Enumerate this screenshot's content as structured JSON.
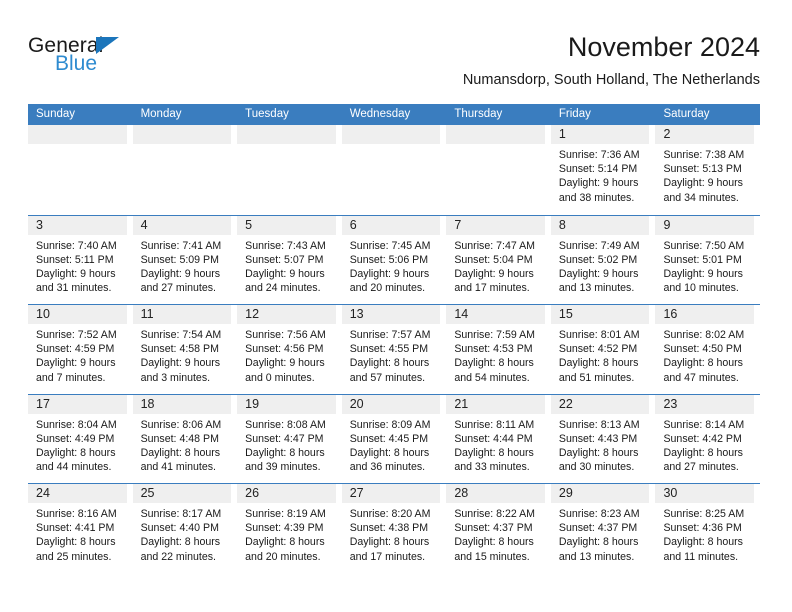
{
  "brand": {
    "word_one": "General",
    "word_two": "Blue",
    "triangle_color": "#1b75bb",
    "blue_text_color": "#2e8bd0"
  },
  "header": {
    "title": "November 2024",
    "subtitle": "Numansdorp, South Holland, The Netherlands"
  },
  "theme": {
    "header_blue": "#3a7dbf",
    "daynum_band": "#efefef",
    "page_background": "#ffffff",
    "text": "#1a1a1a"
  },
  "calendar": {
    "day_headers": [
      "Sunday",
      "Monday",
      "Tuesday",
      "Wednesday",
      "Thursday",
      "Friday",
      "Saturday"
    ],
    "weeks": [
      [
        {
          "day": "",
          "lines": []
        },
        {
          "day": "",
          "lines": []
        },
        {
          "day": "",
          "lines": []
        },
        {
          "day": "",
          "lines": []
        },
        {
          "day": "",
          "lines": []
        },
        {
          "day": "1",
          "lines": [
            "Sunrise: 7:36 AM",
            "Sunset: 5:14 PM",
            "Daylight: 9 hours",
            "and 38 minutes."
          ]
        },
        {
          "day": "2",
          "lines": [
            "Sunrise: 7:38 AM",
            "Sunset: 5:13 PM",
            "Daylight: 9 hours",
            "and 34 minutes."
          ]
        }
      ],
      [
        {
          "day": "3",
          "lines": [
            "Sunrise: 7:40 AM",
            "Sunset: 5:11 PM",
            "Daylight: 9 hours",
            "and 31 minutes."
          ]
        },
        {
          "day": "4",
          "lines": [
            "Sunrise: 7:41 AM",
            "Sunset: 5:09 PM",
            "Daylight: 9 hours",
            "and 27 minutes."
          ]
        },
        {
          "day": "5",
          "lines": [
            "Sunrise: 7:43 AM",
            "Sunset: 5:07 PM",
            "Daylight: 9 hours",
            "and 24 minutes."
          ]
        },
        {
          "day": "6",
          "lines": [
            "Sunrise: 7:45 AM",
            "Sunset: 5:06 PM",
            "Daylight: 9 hours",
            "and 20 minutes."
          ]
        },
        {
          "day": "7",
          "lines": [
            "Sunrise: 7:47 AM",
            "Sunset: 5:04 PM",
            "Daylight: 9 hours",
            "and 17 minutes."
          ]
        },
        {
          "day": "8",
          "lines": [
            "Sunrise: 7:49 AM",
            "Sunset: 5:02 PM",
            "Daylight: 9 hours",
            "and 13 minutes."
          ]
        },
        {
          "day": "9",
          "lines": [
            "Sunrise: 7:50 AM",
            "Sunset: 5:01 PM",
            "Daylight: 9 hours",
            "and 10 minutes."
          ]
        }
      ],
      [
        {
          "day": "10",
          "lines": [
            "Sunrise: 7:52 AM",
            "Sunset: 4:59 PM",
            "Daylight: 9 hours",
            "and 7 minutes."
          ]
        },
        {
          "day": "11",
          "lines": [
            "Sunrise: 7:54 AM",
            "Sunset: 4:58 PM",
            "Daylight: 9 hours",
            "and 3 minutes."
          ]
        },
        {
          "day": "12",
          "lines": [
            "Sunrise: 7:56 AM",
            "Sunset: 4:56 PM",
            "Daylight: 9 hours",
            "and 0 minutes."
          ]
        },
        {
          "day": "13",
          "lines": [
            "Sunrise: 7:57 AM",
            "Sunset: 4:55 PM",
            "Daylight: 8 hours",
            "and 57 minutes."
          ]
        },
        {
          "day": "14",
          "lines": [
            "Sunrise: 7:59 AM",
            "Sunset: 4:53 PM",
            "Daylight: 8 hours",
            "and 54 minutes."
          ]
        },
        {
          "day": "15",
          "lines": [
            "Sunrise: 8:01 AM",
            "Sunset: 4:52 PM",
            "Daylight: 8 hours",
            "and 51 minutes."
          ]
        },
        {
          "day": "16",
          "lines": [
            "Sunrise: 8:02 AM",
            "Sunset: 4:50 PM",
            "Daylight: 8 hours",
            "and 47 minutes."
          ]
        }
      ],
      [
        {
          "day": "17",
          "lines": [
            "Sunrise: 8:04 AM",
            "Sunset: 4:49 PM",
            "Daylight: 8 hours",
            "and 44 minutes."
          ]
        },
        {
          "day": "18",
          "lines": [
            "Sunrise: 8:06 AM",
            "Sunset: 4:48 PM",
            "Daylight: 8 hours",
            "and 41 minutes."
          ]
        },
        {
          "day": "19",
          "lines": [
            "Sunrise: 8:08 AM",
            "Sunset: 4:47 PM",
            "Daylight: 8 hours",
            "and 39 minutes."
          ]
        },
        {
          "day": "20",
          "lines": [
            "Sunrise: 8:09 AM",
            "Sunset: 4:45 PM",
            "Daylight: 8 hours",
            "and 36 minutes."
          ]
        },
        {
          "day": "21",
          "lines": [
            "Sunrise: 8:11 AM",
            "Sunset: 4:44 PM",
            "Daylight: 8 hours",
            "and 33 minutes."
          ]
        },
        {
          "day": "22",
          "lines": [
            "Sunrise: 8:13 AM",
            "Sunset: 4:43 PM",
            "Daylight: 8 hours",
            "and 30 minutes."
          ]
        },
        {
          "day": "23",
          "lines": [
            "Sunrise: 8:14 AM",
            "Sunset: 4:42 PM",
            "Daylight: 8 hours",
            "and 27 minutes."
          ]
        }
      ],
      [
        {
          "day": "24",
          "lines": [
            "Sunrise: 8:16 AM",
            "Sunset: 4:41 PM",
            "Daylight: 8 hours",
            "and 25 minutes."
          ]
        },
        {
          "day": "25",
          "lines": [
            "Sunrise: 8:17 AM",
            "Sunset: 4:40 PM",
            "Daylight: 8 hours",
            "and 22 minutes."
          ]
        },
        {
          "day": "26",
          "lines": [
            "Sunrise: 8:19 AM",
            "Sunset: 4:39 PM",
            "Daylight: 8 hours",
            "and 20 minutes."
          ]
        },
        {
          "day": "27",
          "lines": [
            "Sunrise: 8:20 AM",
            "Sunset: 4:38 PM",
            "Daylight: 8 hours",
            "and 17 minutes."
          ]
        },
        {
          "day": "28",
          "lines": [
            "Sunrise: 8:22 AM",
            "Sunset: 4:37 PM",
            "Daylight: 8 hours",
            "and 15 minutes."
          ]
        },
        {
          "day": "29",
          "lines": [
            "Sunrise: 8:23 AM",
            "Sunset: 4:37 PM",
            "Daylight: 8 hours",
            "and 13 minutes."
          ]
        },
        {
          "day": "30",
          "lines": [
            "Sunrise: 8:25 AM",
            "Sunset: 4:36 PM",
            "Daylight: 8 hours",
            "and 11 minutes."
          ]
        }
      ]
    ]
  }
}
